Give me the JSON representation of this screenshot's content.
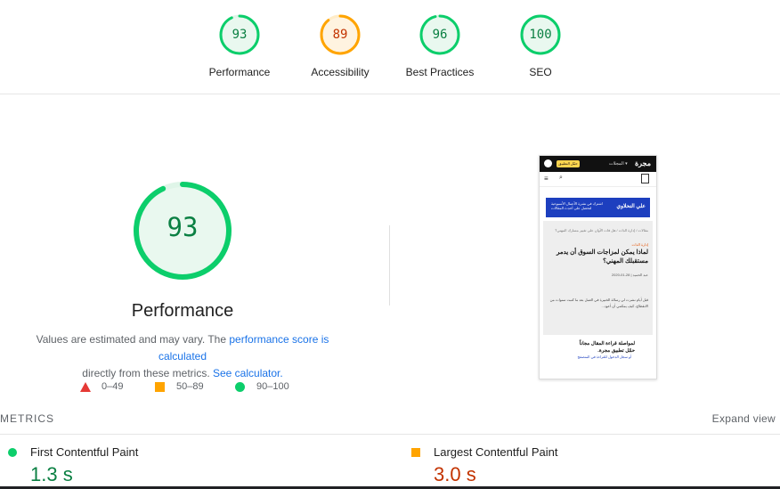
{
  "top_scores": [
    {
      "value": "93",
      "label": "Performance",
      "color": "#0cce6b",
      "text_color": "#0b8043",
      "fraction": 0.93
    },
    {
      "value": "89",
      "label": "Accessibility",
      "color": "#ffa400",
      "text_color": "#c33300",
      "fraction": 0.89
    },
    {
      "value": "96",
      "label": "Best Practices",
      "color": "#0cce6b",
      "text_color": "#0b8043",
      "fraction": 0.96
    },
    {
      "value": "100",
      "label": "SEO",
      "color": "#0cce6b",
      "text_color": "#0b8043",
      "fraction": 1.0
    }
  ],
  "main": {
    "score": "93",
    "score_fraction": 0.93,
    "title": "Performance",
    "desc_1": "Values are estimated and may vary. The ",
    "desc_link": "performance score is calculated",
    "desc_2": "directly from these metrics.",
    "desc_calc": "See calculator."
  },
  "legend": {
    "fail": "0–49",
    "average": "50–89",
    "pass": "90–100"
  },
  "screenshot": {
    "logo": "مجرة",
    "cta_button": "حمّل التطبيق",
    "dropdown": "المجلات ▾",
    "banner_title": "علي النحلاوي",
    "banner_text": "اشترك في نشرة الأعمال الأسبوعية لتحصل على أحدث المقالات",
    "breadcrumb": "مقالات / إدارة الذات / هل فات الأوان على تغيير مسارك المهني؟",
    "category": "إدارة الذات",
    "headline": "لماذا يمكن لمزاجات السوق أن يدمر مستقبلك المهني؟",
    "meta": "2020-01-28 | عبد الحميد",
    "body": "قبل أيام نشرت لي رسالة الخبيرة في العمل بعد ما كتبت سنوات من الانقطاع، كيف يمكنني أن أعود...",
    "cta_line_1": "لمواصلة قراءة المقال مجاناً",
    "cta_line_2": "حمّل تطبيق مجرة.",
    "cta_line_3": "أو سجل الدخول للقراءة في المتصفح"
  },
  "metrics": {
    "header": "METRICS",
    "expand": "Expand view",
    "items": [
      {
        "name": "First Contentful Paint",
        "value": "1.3 s",
        "color": "#0b8043"
      },
      {
        "name": "Largest Contentful Paint",
        "value": "3.0 s",
        "color": "#c33300"
      }
    ]
  }
}
